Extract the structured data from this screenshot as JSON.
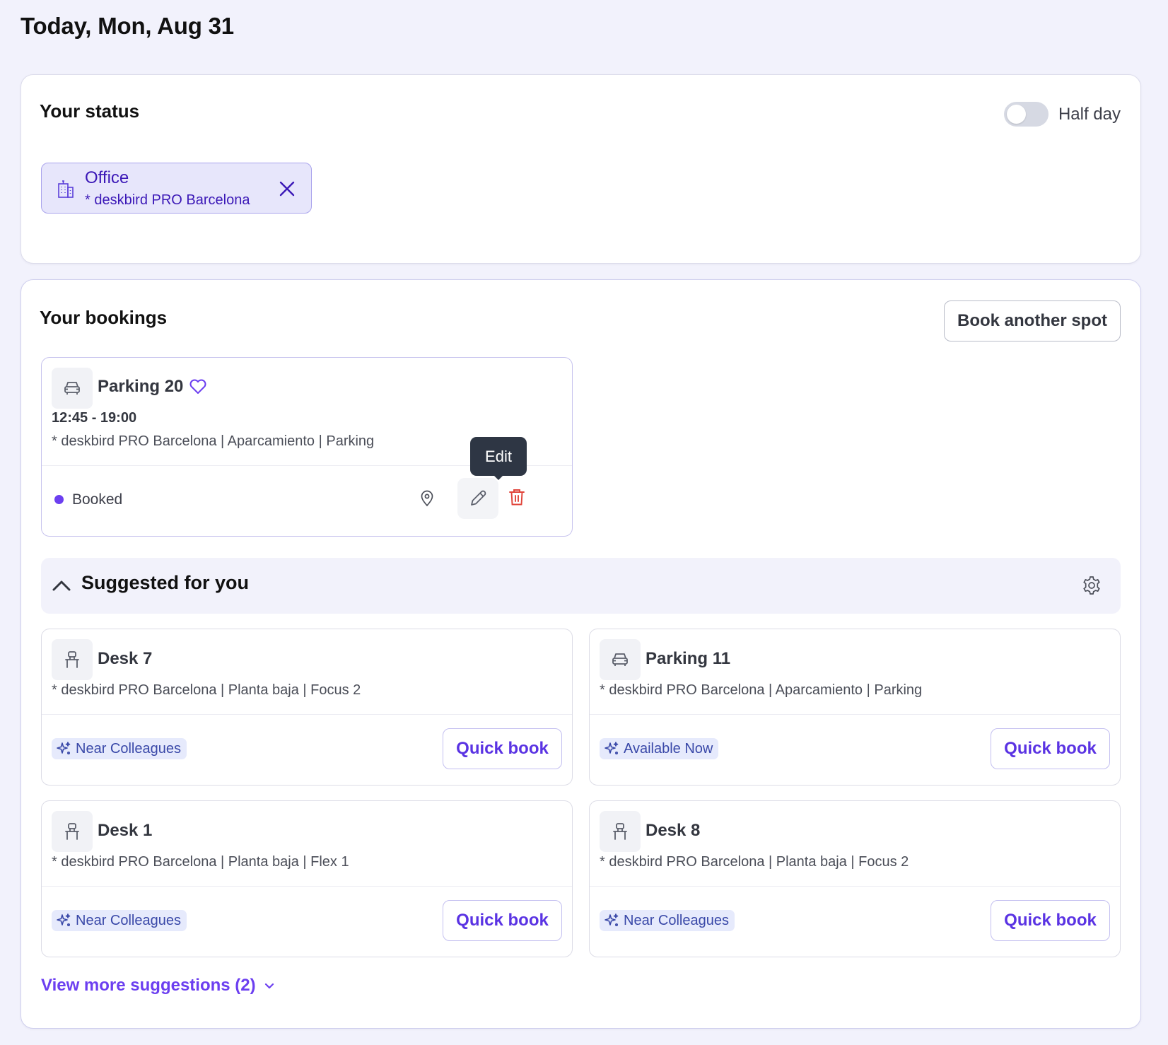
{
  "header": {
    "title": "Today, Mon, Aug 31"
  },
  "status": {
    "title": "Your status",
    "half_day_label": "Half day",
    "half_day_on": false,
    "chip": {
      "label": "Office",
      "location": "* deskbird PRO Barcelona"
    }
  },
  "bookings": {
    "title": "Your bookings",
    "book_another_label": "Book another spot",
    "items": [
      {
        "name": "Parking 20",
        "time": "12:45 - 19:00",
        "location": "* deskbird PRO Barcelona | Aparcamiento | Parking",
        "status": "Booked",
        "favorite": true
      }
    ],
    "tooltip": "Edit"
  },
  "suggestions": {
    "title": "Suggested for you",
    "items": [
      {
        "name": "Desk 7",
        "type": "desk",
        "location": "* deskbird PRO Barcelona | Planta baja | Focus 2",
        "badge": "Near Colleagues",
        "action": "Quick book"
      },
      {
        "name": "Parking 11",
        "type": "parking",
        "location": "* deskbird PRO Barcelona | Aparcamiento | Parking",
        "badge": "Available Now",
        "action": "Quick book"
      },
      {
        "name": "Desk 1",
        "type": "desk",
        "location": "* deskbird PRO Barcelona | Planta baja | Flex 1",
        "badge": "Near Colleagues",
        "action": "Quick book"
      },
      {
        "name": "Desk 8",
        "type": "desk",
        "location": "* deskbird PRO Barcelona | Planta baja | Focus 2",
        "badge": "Near Colleagues",
        "action": "Quick book"
      }
    ],
    "view_more_label": "View more suggestions (2)"
  },
  "colors": {
    "accent": "#6c3ff0",
    "chip_bg": "#e7e6fb",
    "delete": "#e0443a",
    "badge_bg": "#e6eafc"
  }
}
